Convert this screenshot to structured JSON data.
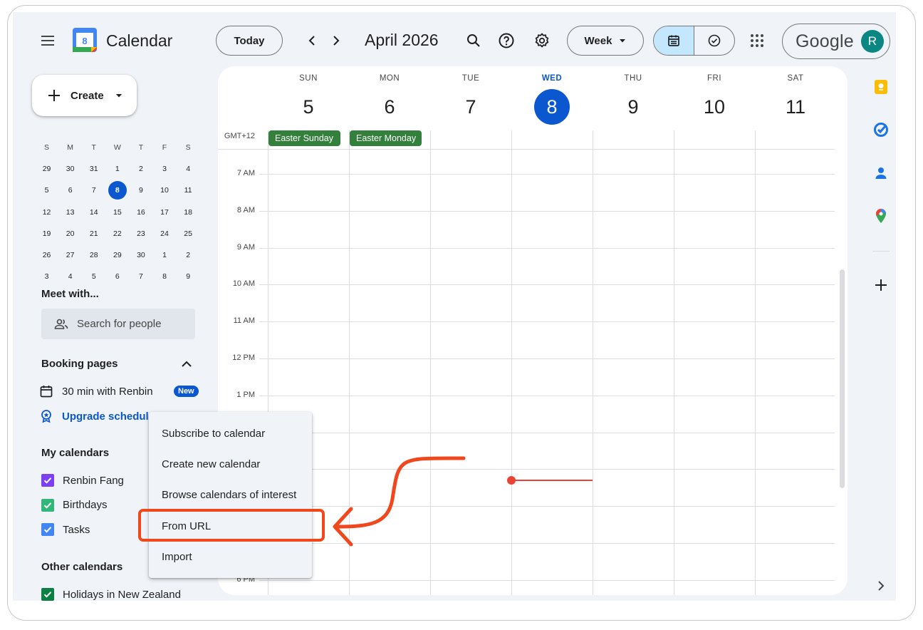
{
  "header": {
    "app_name": "Calendar",
    "logo_day": "8",
    "today_label": "Today",
    "month_label": "April 2026",
    "view_label": "Week",
    "google_text": "Google",
    "avatar_letter": "R"
  },
  "sidebar": {
    "create_label": "Create",
    "mini_cal_headers": [
      "S",
      "M",
      "T",
      "W",
      "T",
      "F",
      "S"
    ],
    "mini_cal_weeks": [
      [
        "29",
        "30",
        "31",
        "1",
        "2",
        "3",
        "4"
      ],
      [
        "5",
        "6",
        "7",
        "8",
        "9",
        "10",
        "11"
      ],
      [
        "12",
        "13",
        "14",
        "15",
        "16",
        "17",
        "18"
      ],
      [
        "19",
        "20",
        "21",
        "22",
        "23",
        "24",
        "25"
      ],
      [
        "26",
        "27",
        "28",
        "29",
        "30",
        "1",
        "2"
      ],
      [
        "3",
        "4",
        "5",
        "6",
        "7",
        "8",
        "9"
      ]
    ],
    "selected_day": "8",
    "meet_with_title": "Meet with...",
    "search_people_placeholder": "Search for people",
    "booking_pages_title": "Booking pages",
    "booking_item": "30 min with Renbin",
    "new_badge": "New",
    "upgrade_label": "Upgrade schedul",
    "my_calendars_title": "My calendars",
    "my_calendars": [
      {
        "label": "Renbin Fang",
        "color": "#7e3ff2"
      },
      {
        "label": "Birthdays",
        "color": "#33b679"
      },
      {
        "label": "Tasks",
        "color": "#4285f4"
      }
    ],
    "other_calendars_title": "Other calendars",
    "other_calendars": [
      {
        "label": "Holidays in New Zealand",
        "color": "#0b8043"
      }
    ]
  },
  "week": {
    "days": [
      {
        "name": "SUN",
        "num": "5"
      },
      {
        "name": "MON",
        "num": "6"
      },
      {
        "name": "TUE",
        "num": "7"
      },
      {
        "name": "WED",
        "num": "8"
      },
      {
        "name": "THU",
        "num": "9"
      },
      {
        "name": "FRI",
        "num": "10"
      },
      {
        "name": "SAT",
        "num": "11"
      }
    ],
    "today_index": 3,
    "timezone": "GMT+12",
    "time_labels": [
      "7 AM",
      "8 AM",
      "9 AM",
      "10 AM",
      "11 AM",
      "12 PM",
      "1 PM",
      "6 PM"
    ],
    "all_day_events": [
      {
        "label": "Easter Sunday",
        "day": "SUN"
      },
      {
        "label": "Easter Monday",
        "day": "MON"
      }
    ]
  },
  "menu": {
    "items": [
      "Subscribe to calendar",
      "Create new calendar",
      "Browse calendars of interest",
      "From URL",
      "Import"
    ],
    "highlighted": "From URL"
  },
  "colors": {
    "accent": "#0b57d0",
    "event_green": "#33803d",
    "annotation": "#f1471d",
    "now_line": "#ea4335"
  },
  "rail_icons": [
    "keep-icon",
    "tasks-icon",
    "contacts-icon",
    "maps-icon",
    "add-icon",
    "expand-icon"
  ]
}
